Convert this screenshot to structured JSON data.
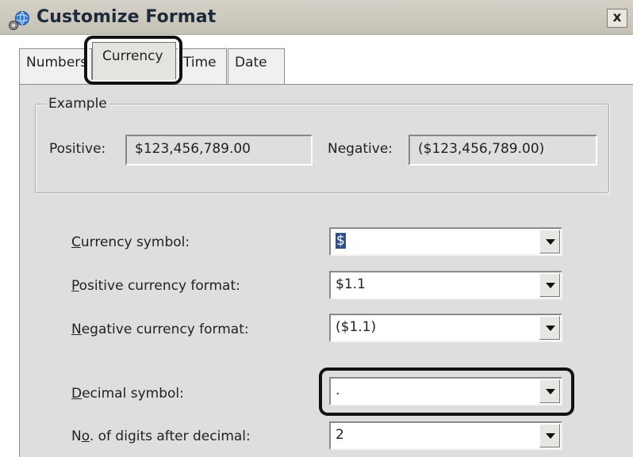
{
  "window": {
    "title": "Customize Format",
    "close_label": "x",
    "title_icon": "globe-settings-icon",
    "close_icon": "close-icon"
  },
  "tabs": [
    {
      "label": "Numbers",
      "active": false
    },
    {
      "label": "Currency",
      "active": true
    },
    {
      "label": "Time",
      "active": false
    },
    {
      "label": "Date",
      "active": false
    }
  ],
  "example": {
    "legend": "Example",
    "positive_label": "Positive:",
    "positive_value": "$123,456,789.00",
    "negative_label": "Negative:",
    "negative_value": "($123,456,789.00)"
  },
  "fields": [
    {
      "access_key": "C",
      "label_rest": "urrency symbol:",
      "label_pre": "",
      "value": "$",
      "selected": true
    },
    {
      "access_key": "P",
      "label_rest": "ositive currency format:",
      "label_pre": "",
      "value": "$1.1",
      "selected": false
    },
    {
      "access_key": "N",
      "label_rest": "egative currency format:",
      "label_pre": "",
      "value": "($1.1)",
      "selected": false
    },
    {
      "access_key": "D",
      "label_rest": "ecimal symbol:",
      "label_pre": "",
      "value": ".",
      "selected": false
    },
    {
      "access_key": "o",
      "label_rest": ". of digits after decimal:",
      "label_pre": "N",
      "value": "2",
      "selected": false
    }
  ],
  "colors": {
    "title_bar": "#cbc6bc",
    "panel": "#dedede",
    "selection": "#2f4f8f",
    "highlight_outline": "#111111"
  }
}
